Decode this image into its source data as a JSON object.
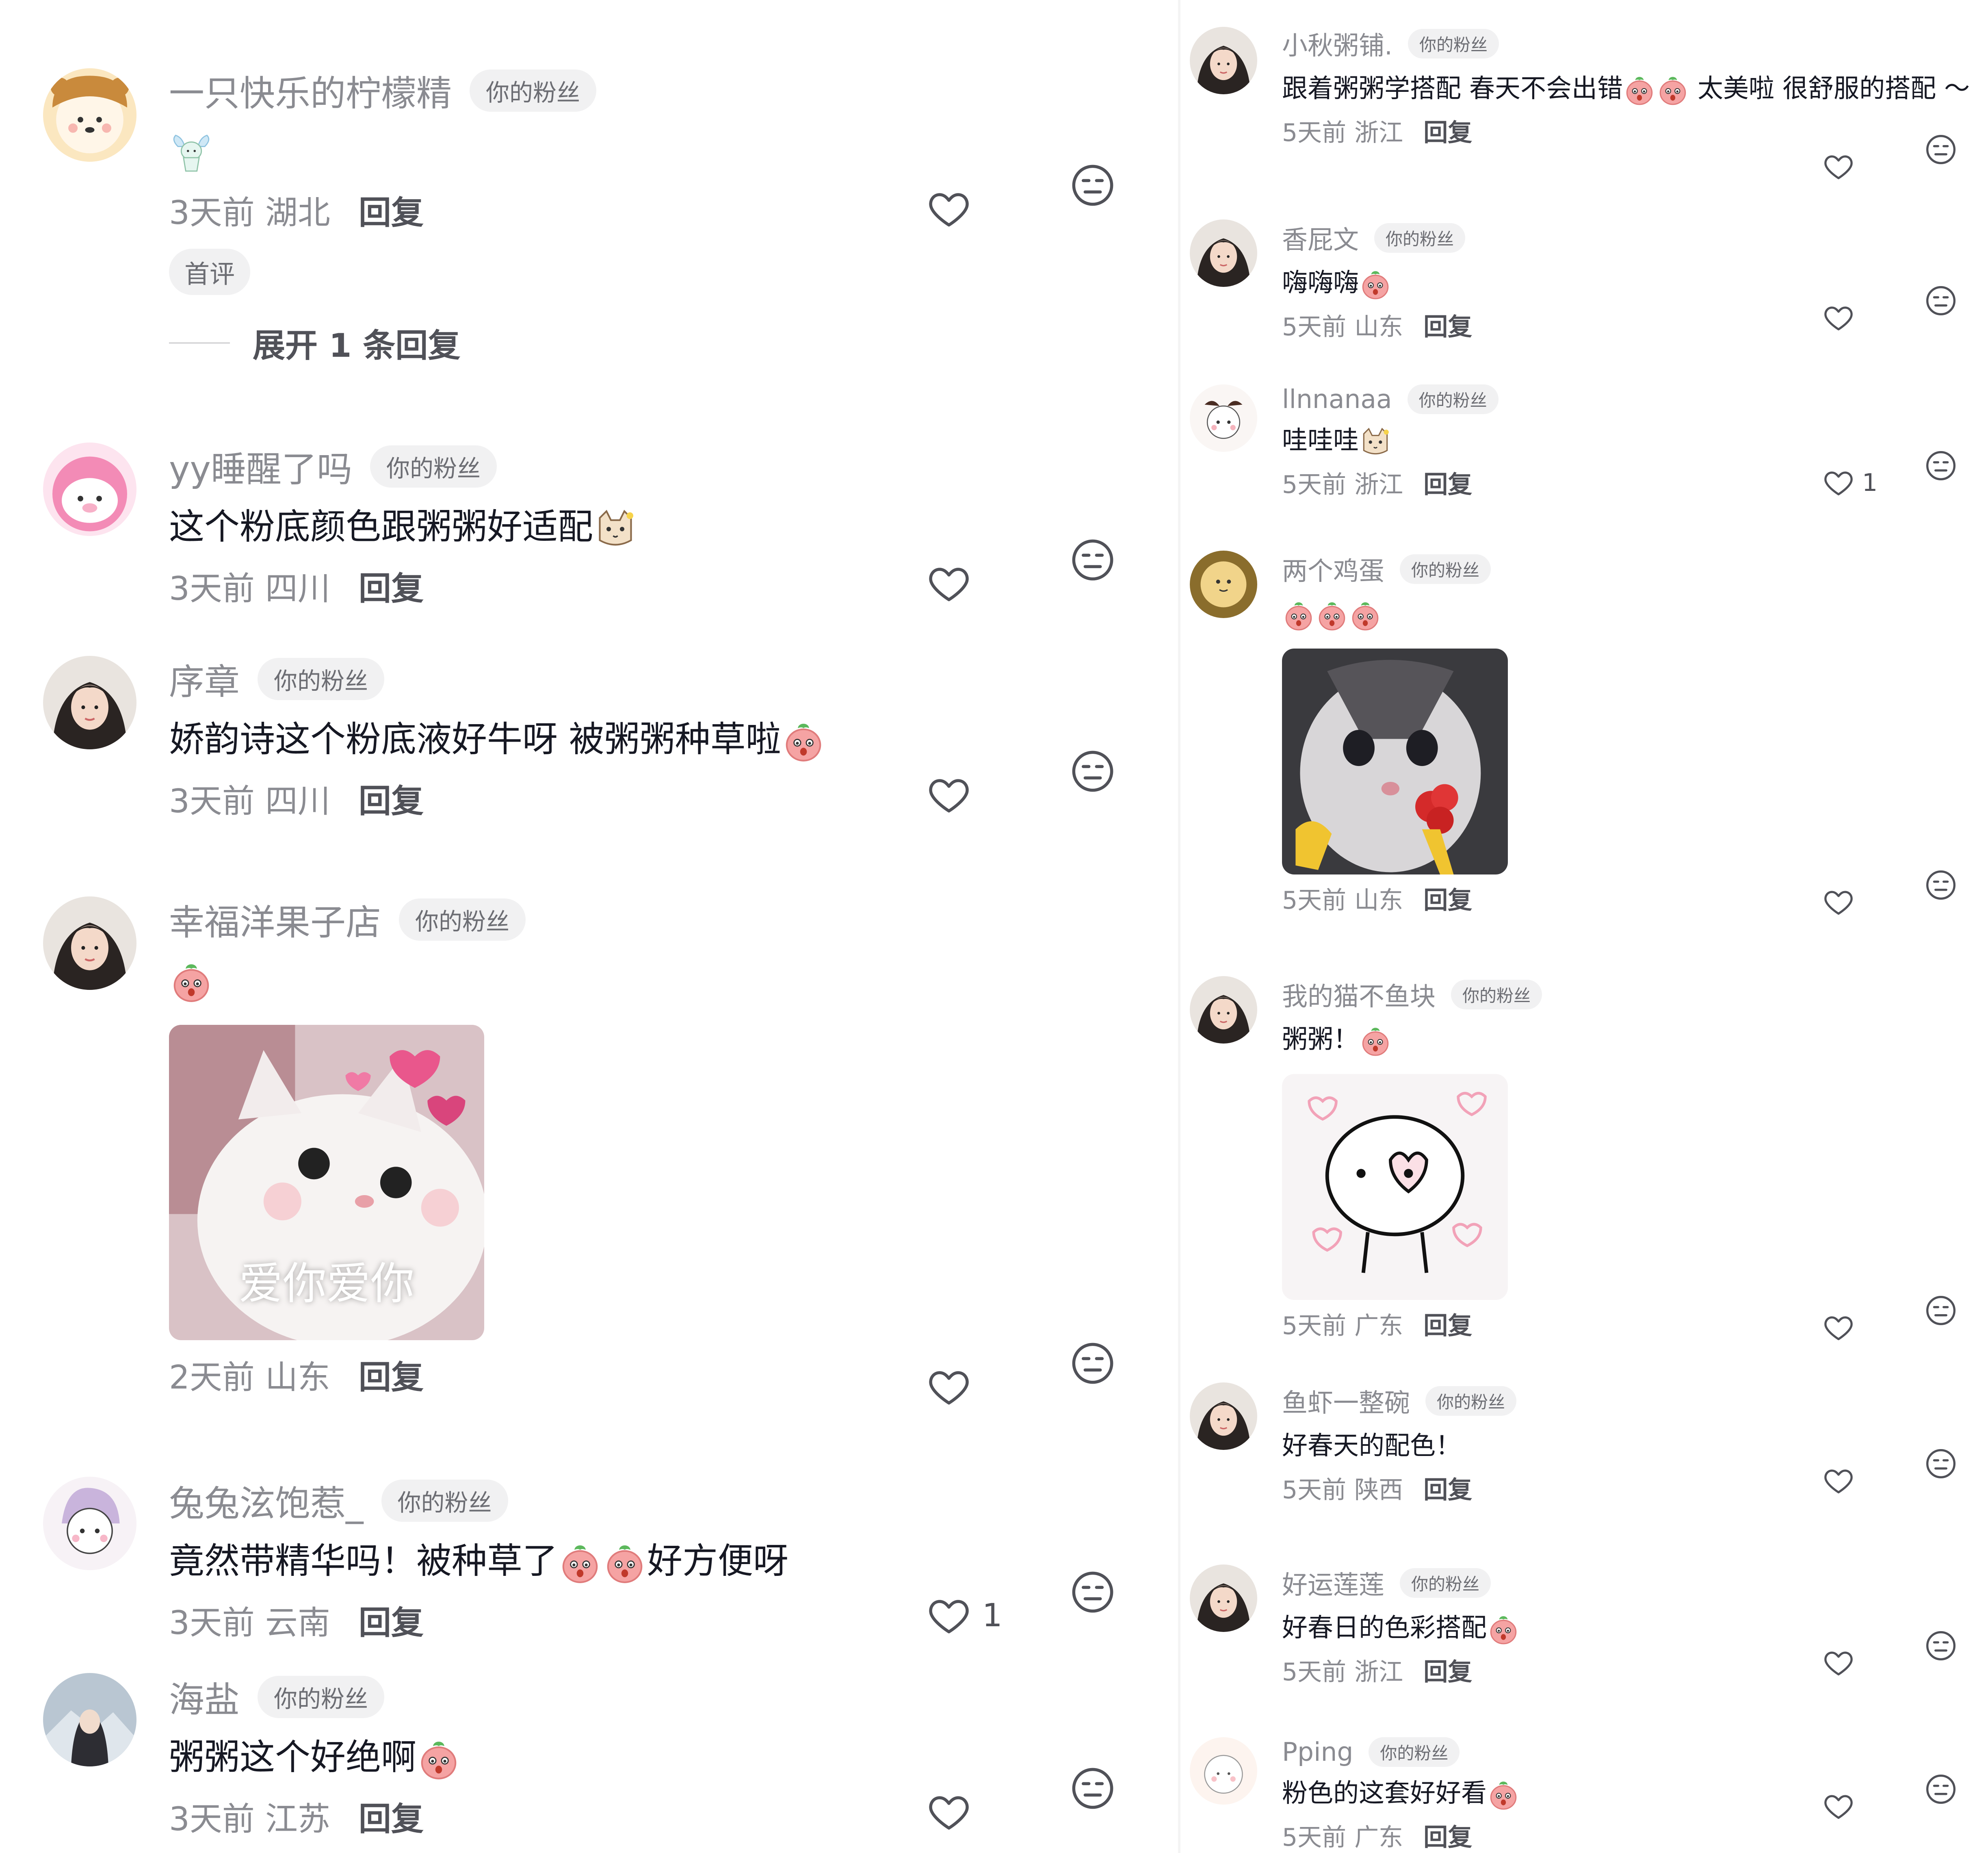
{
  "left": {
    "comments": [
      {
        "name": "一只快乐的柠檬精",
        "badge": "你的粉丝",
        "text": "",
        "time": "3天前",
        "region": "湖北",
        "reply": "回复",
        "likes": "",
        "first_tag": "首评",
        "expand": "展开 1 条回复"
      },
      {
        "name": "yy睡醒了吗",
        "badge": "你的粉丝",
        "text": "这个粉底颜色跟粥粥好适配",
        "time": "3天前",
        "region": "四川",
        "reply": "回复",
        "likes": ""
      },
      {
        "name": "序章",
        "badge": "你的粉丝",
        "text": "娇韵诗这个粉底液好牛呀 被粥粥种草啦",
        "time": "3天前",
        "region": "四川",
        "reply": "回复",
        "likes": ""
      },
      {
        "name": "幸福洋果子店",
        "badge": "你的粉丝",
        "text": "",
        "image_caption": "爱你爱你",
        "time": "2天前",
        "region": "山东",
        "reply": "回复",
        "likes": ""
      },
      {
        "name": "兔兔泫饱惹_",
        "badge": "你的粉丝",
        "text_a": "竟然带精华吗！被种草了",
        "text_b": "好方便呀",
        "time": "3天前",
        "region": "云南",
        "reply": "回复",
        "likes": "1"
      },
      {
        "name": "海盐",
        "badge": "你的粉丝",
        "text": "粥粥这个好绝啊",
        "time": "3天前",
        "region": "江苏",
        "reply": "回复",
        "likes": ""
      }
    ]
  },
  "right": {
    "comments": [
      {
        "name": "小秋粥铺.",
        "badge": "你的粉丝",
        "text_a": "跟着粥粥学搭配 春天不会出错",
        "text_b": " 太美啦 很舒服的搭配 ～",
        "time": "5天前",
        "region": "浙江",
        "reply": "回复",
        "likes": ""
      },
      {
        "name": "香屁文",
        "badge": "你的粉丝",
        "text": "嗨嗨嗨",
        "time": "5天前",
        "region": "山东",
        "reply": "回复",
        "likes": ""
      },
      {
        "name": "llnnanaa",
        "badge": "你的粉丝",
        "text": "哇哇哇",
        "time": "5天前",
        "region": "浙江",
        "reply": "回复",
        "likes": "1"
      },
      {
        "name": "两个鸡蛋",
        "badge": "你的粉丝",
        "text": "",
        "time": "5天前",
        "region": "山东",
        "reply": "回复",
        "likes": ""
      },
      {
        "name": "我的猫不鱼块",
        "badge": "你的粉丝",
        "text": "粥粥！",
        "time": "5天前",
        "region": "广东",
        "reply": "回复",
        "likes": ""
      },
      {
        "name": "鱼虾一整碗",
        "badge": "你的粉丝",
        "text": "好春天的配色！",
        "time": "5天前",
        "region": "陕西",
        "reply": "回复",
        "likes": ""
      },
      {
        "name": "好运莲莲",
        "badge": "你的粉丝",
        "text": "好春日的色彩搭配",
        "time": "5天前",
        "region": "浙江",
        "reply": "回复",
        "likes": ""
      },
      {
        "name": "Pping",
        "badge": "你的粉丝",
        "text": "粉色的这套好好看",
        "time": "5天前",
        "region": "广东",
        "reply": "回复",
        "likes": ""
      }
    ]
  },
  "icons": {
    "like": "heart-outline-icon",
    "dislike": "meh-face-icon",
    "emoji": "peach-face-emoji"
  },
  "colors": {
    "name_gray": "#8a8b91",
    "text": "#161823",
    "badge_bg": "#f1f1f2",
    "emoji_pink": "#f28a8a"
  }
}
